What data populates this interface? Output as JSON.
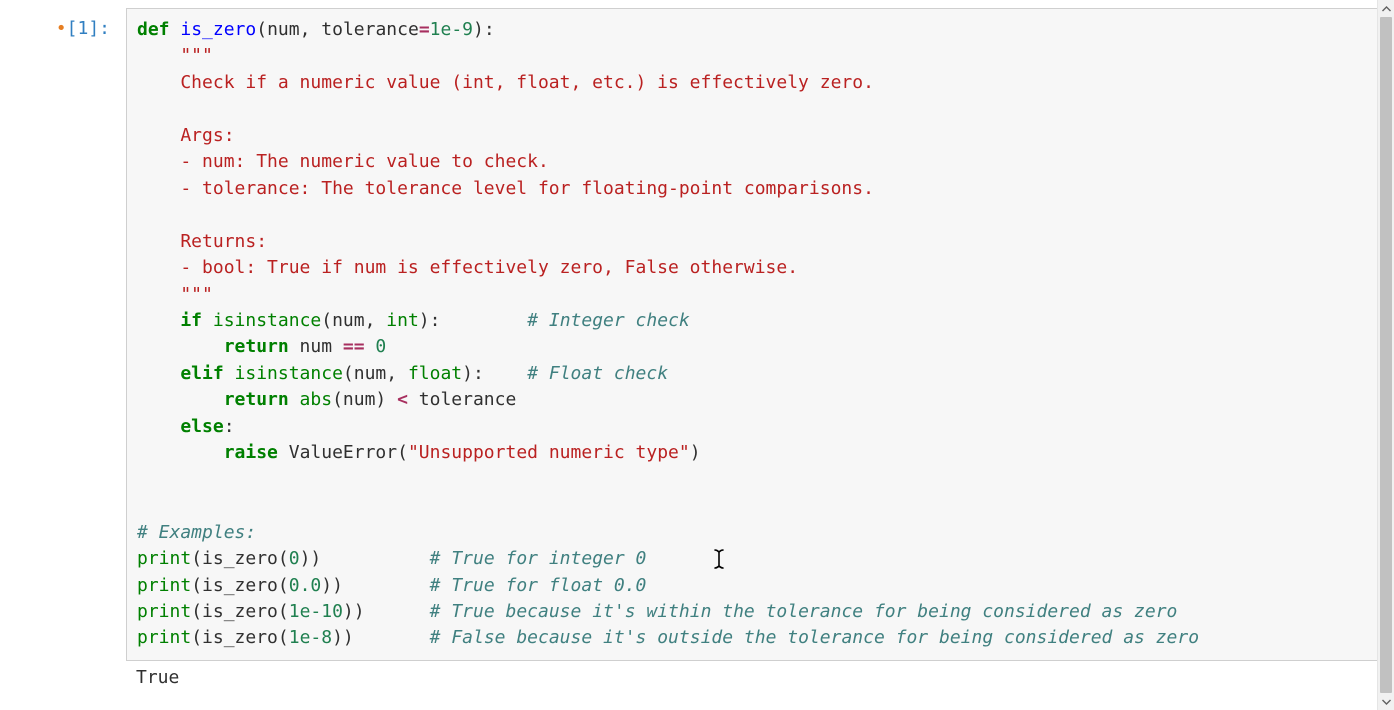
{
  "prompt": {
    "modified_dot": "•",
    "exec_label": "[1]:"
  },
  "code": {
    "l1_def": "def",
    "l1_name": " is_zero",
    "l1_paren_open": "(",
    "l1_arg1": "num",
    "l1_comma": ", ",
    "l1_arg2": "tolerance",
    "l1_eq": "=",
    "l1_default": "1e-9",
    "l1_close": "):",
    "l2_triplequote": "    \"\"\"",
    "l3_doc": "    Check if a numeric value (int, float, etc.) is effectively zero.",
    "l4_blank": "",
    "l5_doc": "    Args:",
    "l6_doc": "    - num: The numeric value to check.",
    "l7_doc": "    - tolerance: The tolerance level for floating-point comparisons.",
    "l8_blank": "",
    "l9_doc": "    Returns:",
    "l10_doc": "    - bool: True if num is effectively zero, False otherwise.",
    "l11_triplequote": "    \"\"\"",
    "l12_if": "    if",
    "l12_isinstance": " isinstance",
    "l12_open": "(num, ",
    "l12_int": "int",
    "l12_close": "):",
    "l12_pad": "        ",
    "l12_com": "# Integer check",
    "l13_return": "        return",
    "l13_expr_a": " num ",
    "l13_op": "==",
    "l13_zero": " 0",
    "l14_elif": "    elif",
    "l14_isinstance": " isinstance",
    "l14_open": "(num, ",
    "l14_float": "float",
    "l14_close": "):",
    "l14_pad": "    ",
    "l14_com": "# Float check",
    "l15_return": "        return",
    "l15_abs": " abs",
    "l15_open": "(num) ",
    "l15_op": "<",
    "l15_tol": " tolerance",
    "l16_else": "    else",
    "l16_colon": ":",
    "l17_raise": "        raise",
    "l17_ve": " ValueError",
    "l17_open": "(",
    "l17_str": "\"Unsupported numeric type\"",
    "l17_close": ")",
    "l18_blank": "",
    "l19_blank": "",
    "l20_com": "# Examples:",
    "l21_print": "print",
    "l21_open": "(is_zero(",
    "l21_arg": "0",
    "l21_close": "))",
    "l21_pad": "          ",
    "l21_com": "# True for integer 0",
    "l22_print": "print",
    "l22_open": "(is_zero(",
    "l22_arg": "0.0",
    "l22_close": "))",
    "l22_pad": "        ",
    "l22_com": "# True for float 0.0",
    "l23_print": "print",
    "l23_open": "(is_zero(",
    "l23_arg": "1e-10",
    "l23_close": "))",
    "l23_pad": "      ",
    "l23_com": "# True because it's within the tolerance for being considered as zero",
    "l24_print": "print",
    "l24_open": "(is_zero(",
    "l24_arg": "1e-8",
    "l24_close": "))",
    "l24_pad": "       ",
    "l24_com": "# False because it's outside the tolerance for being considered as zero"
  },
  "output": {
    "line1": "True"
  }
}
